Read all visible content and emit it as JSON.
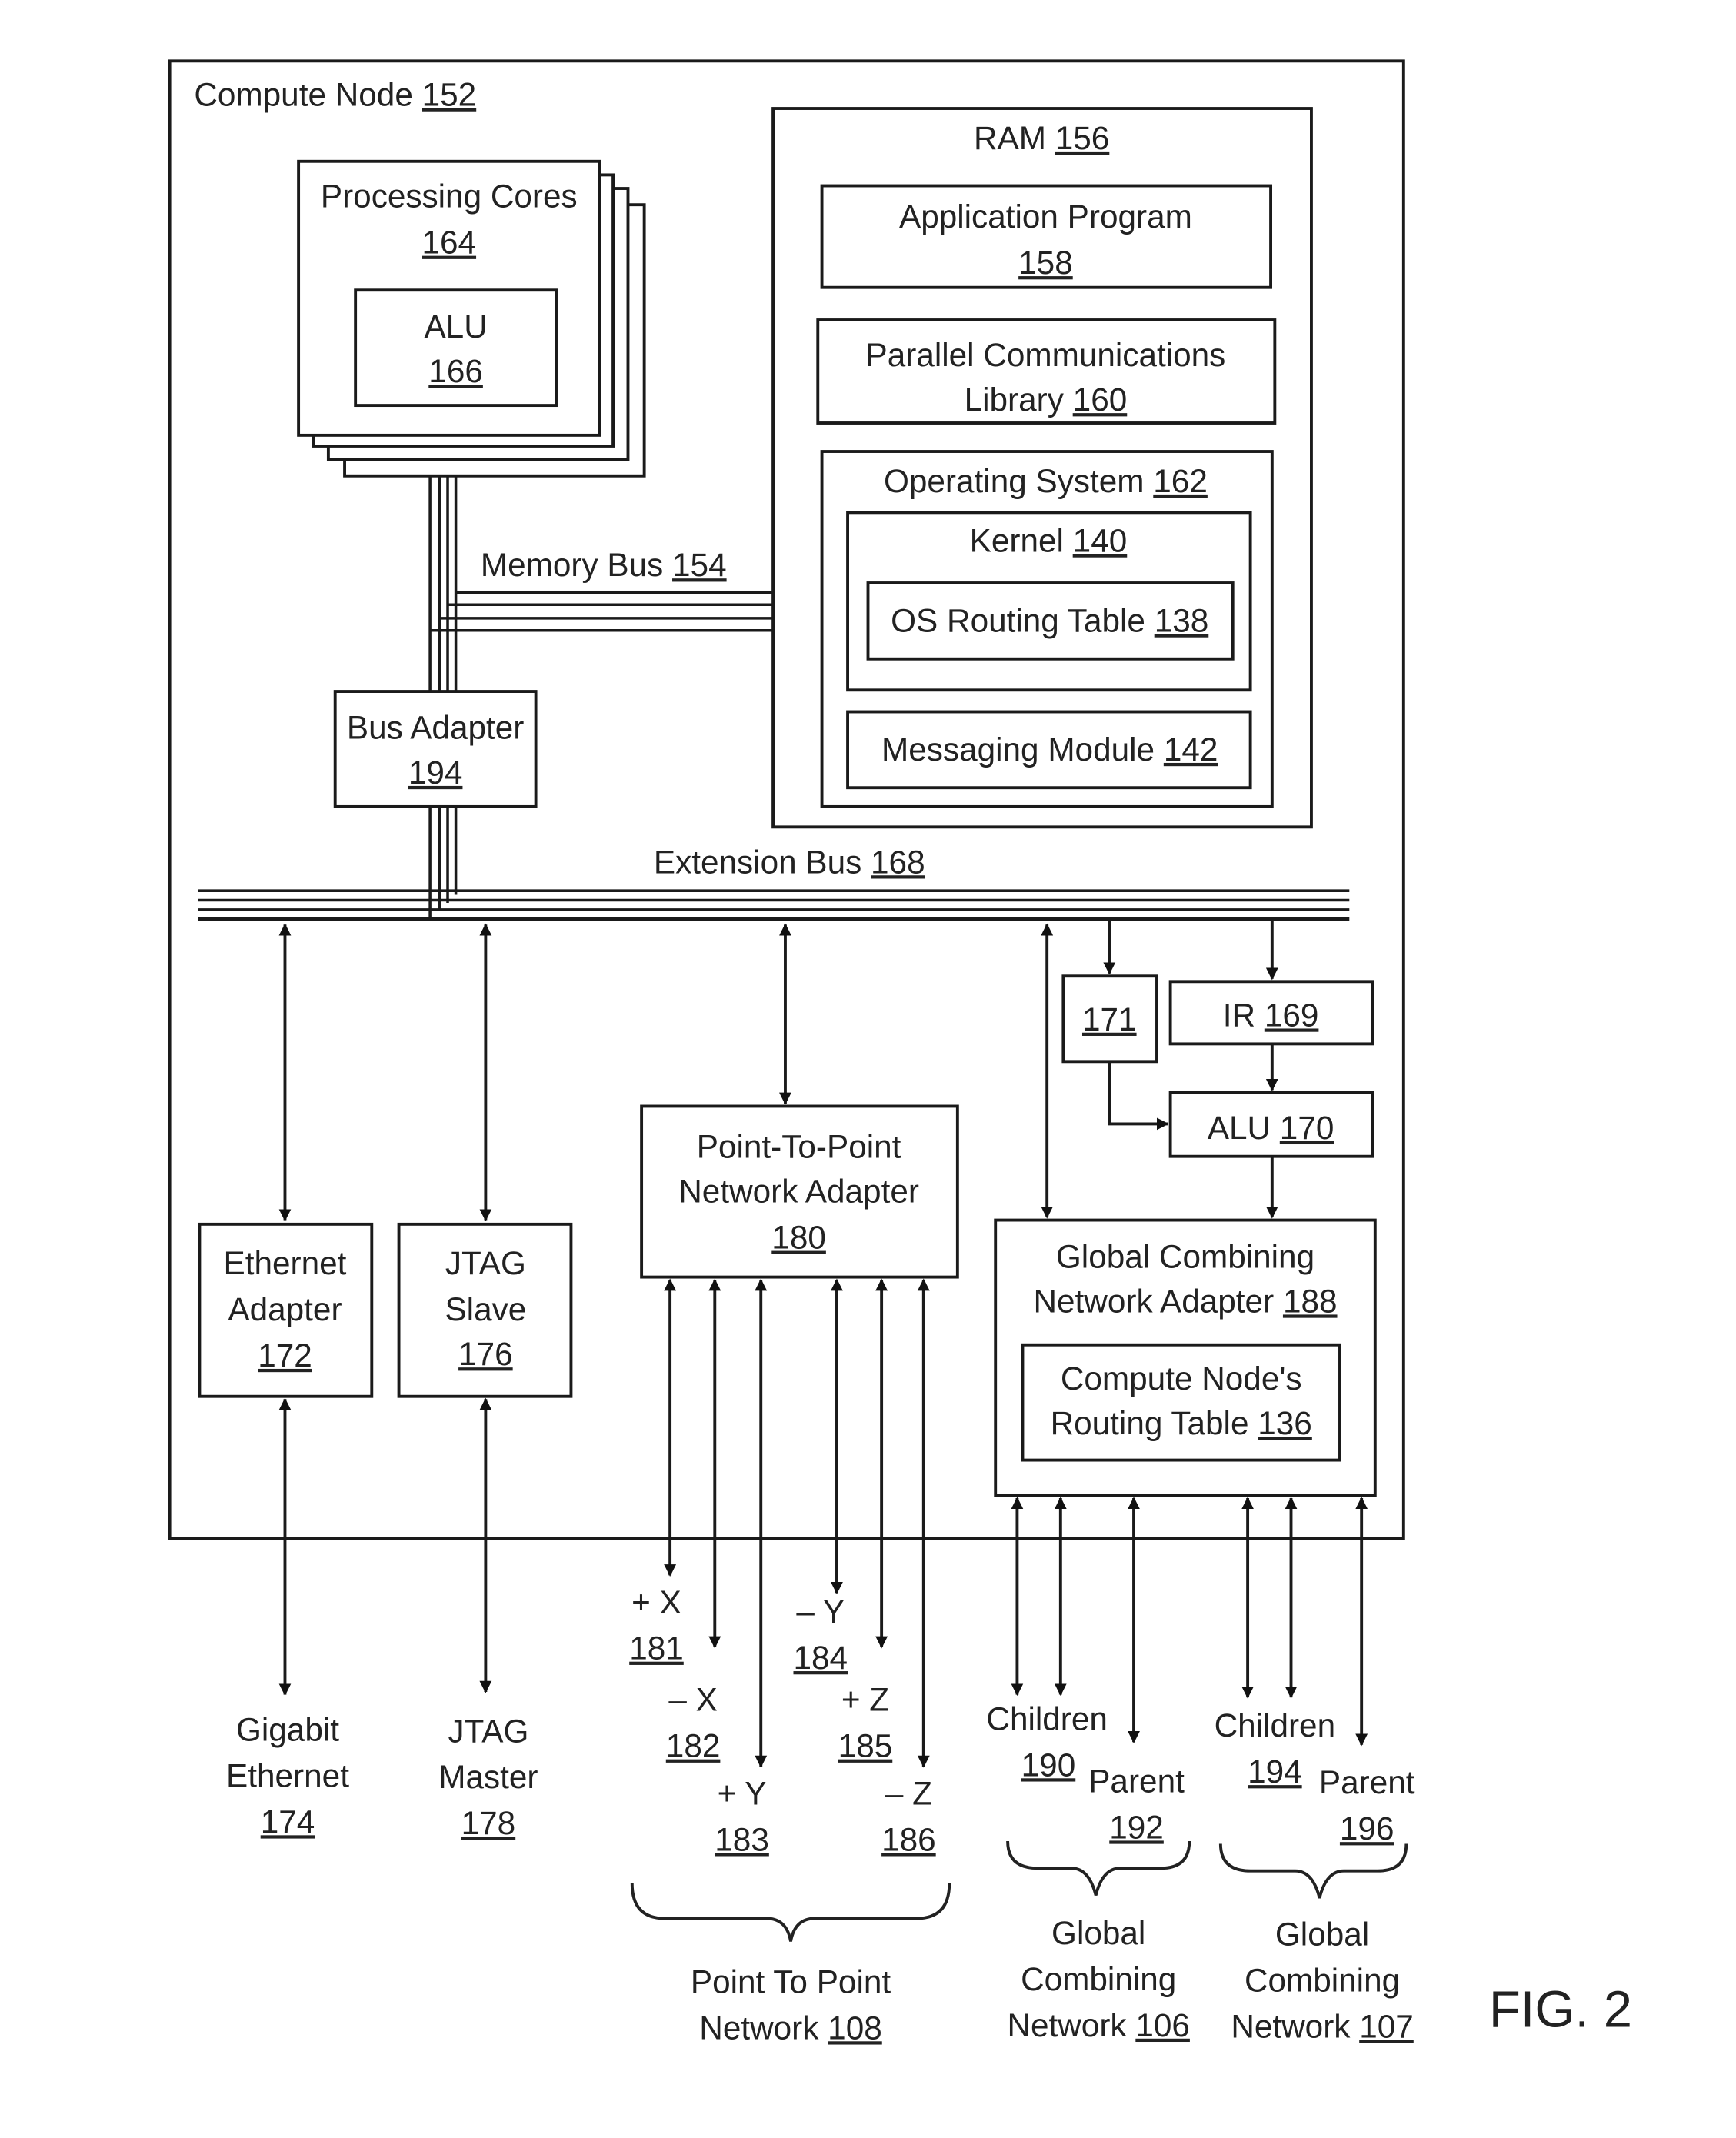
{
  "figure_label": "FIG. 2",
  "compute_node": {
    "label": "Compute Node",
    "ref": "152"
  },
  "processing_cores": {
    "label": "Processing Cores",
    "ref": "164"
  },
  "alu_core": {
    "label": "ALU",
    "ref": "166"
  },
  "ram": {
    "label": "RAM",
    "ref": "156"
  },
  "application_program": {
    "label": "Application Program",
    "ref": "158"
  },
  "parallel_comm_library": {
    "line1": "Parallel Communications",
    "line2": "Library",
    "ref": "160"
  },
  "operating_system": {
    "label": "Operating System",
    "ref": "162"
  },
  "kernel": {
    "label": "Kernel",
    "ref": "140"
  },
  "os_routing_table": {
    "label": "OS Routing Table",
    "ref": "138"
  },
  "messaging_module": {
    "label": "Messaging Module",
    "ref": "142"
  },
  "memory_bus": {
    "label": "Memory Bus",
    "ref": "154"
  },
  "bus_adapter": {
    "label": "Bus Adapter",
    "ref": "194"
  },
  "extension_bus": {
    "label": "Extension Bus",
    "ref": "168"
  },
  "box_171": {
    "ref": "171"
  },
  "ir": {
    "label": "IR",
    "ref": "169"
  },
  "alu_170": {
    "label": "ALU",
    "ref": "170"
  },
  "ethernet_adapter": {
    "line1": "Ethernet",
    "line2": "Adapter",
    "ref": "172"
  },
  "jtag_slave": {
    "line1": "JTAG",
    "line2": "Slave",
    "ref": "176"
  },
  "p2p_adapter": {
    "line1": "Point-To-Point",
    "line2": "Network Adapter",
    "ref": "180"
  },
  "gcn_adapter": {
    "line1": "Global Combining",
    "line2": "Network Adapter",
    "ref": "188"
  },
  "cn_routing_table": {
    "line1": "Compute Node's",
    "line2": "Routing Table",
    "ref": "136"
  },
  "gigabit_ethernet": {
    "line1": "Gigabit",
    "line2": "Ethernet",
    "ref": "174"
  },
  "jtag_master": {
    "line1": "JTAG",
    "line2": "Master",
    "ref": "178"
  },
  "links": [
    {
      "label": "+ X",
      "ref": "181"
    },
    {
      "label": "– X",
      "ref": "182"
    },
    {
      "label": "+ Y",
      "ref": "183"
    },
    {
      "label": "– Y",
      "ref": "184"
    },
    {
      "label": "+ Z",
      "ref": "185"
    },
    {
      "label": "– Z",
      "ref": "186"
    }
  ],
  "gcn1": {
    "children": "Children",
    "children_ref": "190",
    "parent": "Parent",
    "parent_ref": "192"
  },
  "gcn2": {
    "children": "Children",
    "children_ref": "194",
    "parent": "Parent",
    "parent_ref": "196"
  },
  "p2p_network": {
    "line1": "Point To Point",
    "line2": "Network",
    "ref": "108"
  },
  "gc_network_106": {
    "line1": "Global",
    "line2": "Combining",
    "line3": "Network",
    "ref": "106"
  },
  "gc_network_107": {
    "line1": "Global",
    "line2": "Combining",
    "line3": "Network",
    "ref": "107"
  }
}
